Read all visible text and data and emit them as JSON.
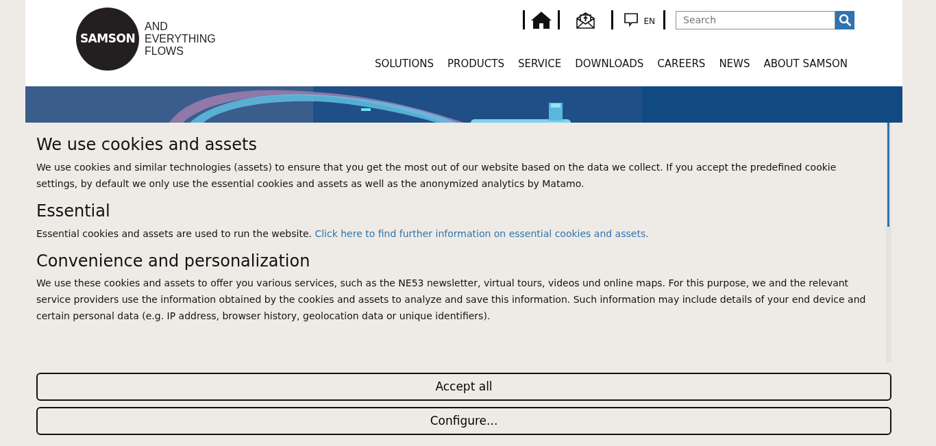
{
  "header": {
    "logo": {
      "mark": "SAMSON",
      "tagline": [
        "AND",
        "EVERYTHING",
        "FLOWS"
      ]
    },
    "language": "EN",
    "search": {
      "placeholder": "Search"
    },
    "nav": [
      "SOLUTIONS",
      "PRODUCTS",
      "SERVICE",
      "DOWNLOADS",
      "CAREERS",
      "NEWS",
      "ABOUT SAMSON"
    ]
  },
  "cookie_dialog": {
    "sections": [
      {
        "title": "We use cookies and assets",
        "text": "We use cookies and similar technologies (assets) to ensure that you get the most out of our website based on the data we collect. If you accept the predefined cookie settings, by default we only use the essential cookies and assets as well as the anonymized analytics by Matamo."
      },
      {
        "title": "Essential",
        "text": "Essential cookies and assets are used to run the website.",
        "link": "Click here to find further information on essential cookies and assets."
      },
      {
        "title": "Convenience and personalization",
        "text": "We use these cookies and assets to offer you various services, such as the NE53 newsletter, virtual tours, videos und online maps. For this purpose, we and the relevant service providers use the information obtained by the cookies and assets to analyze and save this information. Such information may include details of your end device and certain personal data (e.g. IP address, browser history, geolocation data or unique identifiers)."
      }
    ],
    "buttons": [
      "Accept all",
      "Configure..."
    ]
  }
}
